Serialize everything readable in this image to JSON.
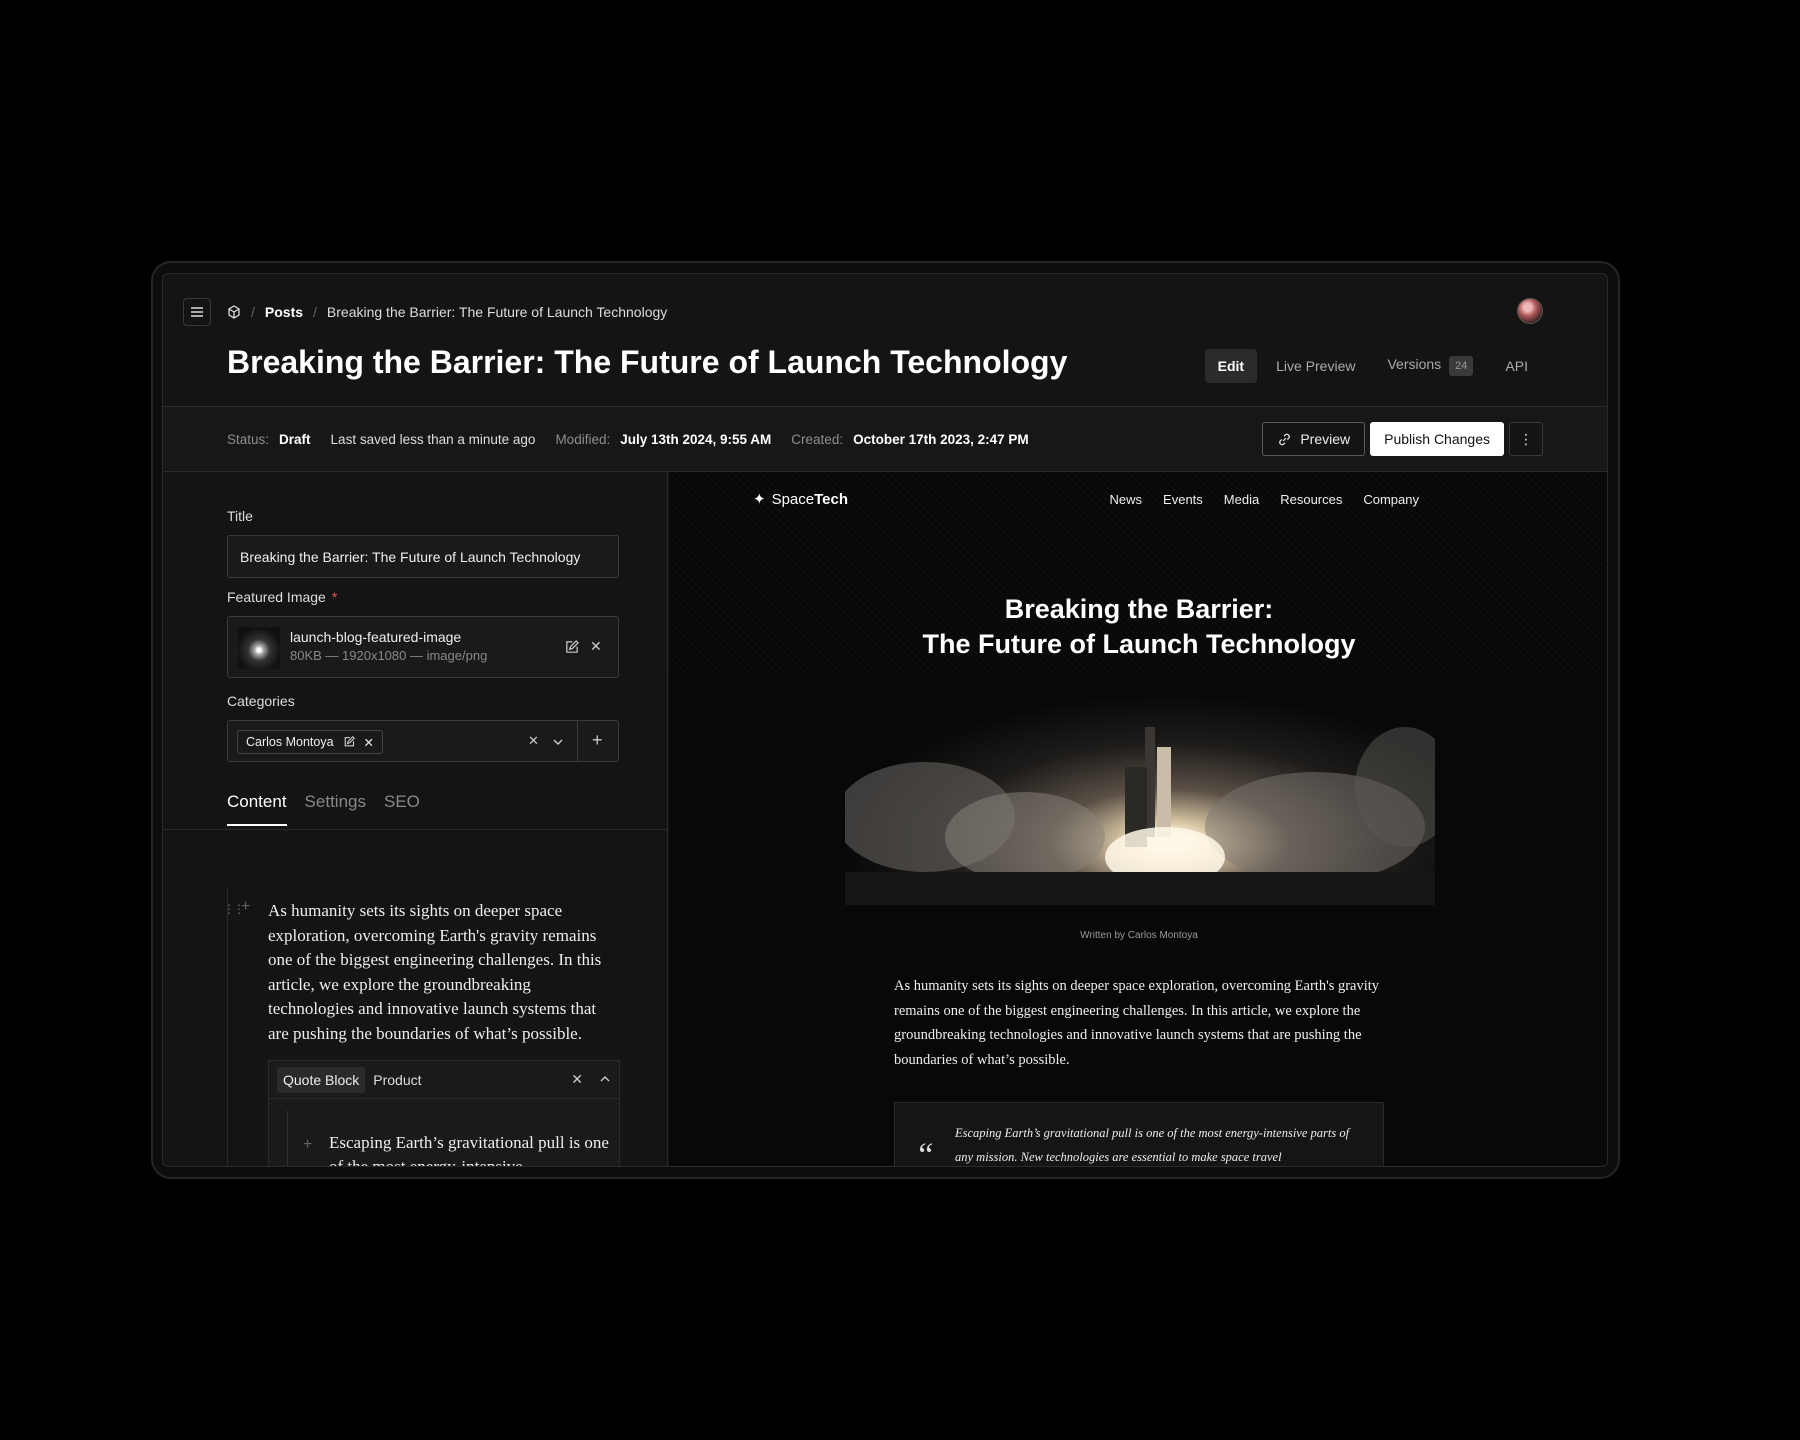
{
  "breadcrumb": {
    "section": "Posts",
    "current": "Breaking the Barrier: The Future of Launch Technology"
  },
  "page": {
    "title": "Breaking the Barrier: The Future of Launch Technology"
  },
  "view_tabs": {
    "edit": "Edit",
    "live_preview": "Live Preview",
    "versions": "Versions",
    "versions_count": "24",
    "api": "API"
  },
  "status": {
    "status_label": "Status:",
    "status_value": "Draft",
    "saved": "Last saved less than a minute ago",
    "modified_label": "Modified:",
    "modified_value": "July 13th 2024, 9:55 AM",
    "created_label": "Created:",
    "created_value": "October 17th 2023, 2:47 PM"
  },
  "actions": {
    "preview": "Preview",
    "publish": "Publish Changes"
  },
  "form": {
    "title_label": "Title",
    "title_value": "Breaking the Barrier: The Future of Launch Technology",
    "image_label": "Featured Image",
    "image_required": "*",
    "image_name": "launch-blog-featured-image",
    "image_meta": "80KB — 1920x1080 — image/png",
    "categories_label": "Categories",
    "category_chip": "Carlos Montoya"
  },
  "content_tabs": {
    "content": "Content",
    "settings": "Settings",
    "seo": "SEO"
  },
  "editor": {
    "paragraph": "As humanity sets its sights on deeper space exploration, overcoming Earth's gravity remains one of the biggest engineering challenges. In this article, we explore the groundbreaking technologies and innovative launch systems that are pushing the boundaries of what’s possible.",
    "block_type": "Quote Block",
    "block_name": "Product",
    "quote_text": "Escaping Earth’s gravitational pull is one of the most energy-intensive"
  },
  "site": {
    "logo_light": "Space",
    "logo_bold": "Tech",
    "nav": [
      "News",
      "Events",
      "Media",
      "Resources",
      "Company"
    ],
    "title_line1": "Breaking the Barrier:",
    "title_line2": "The Future of Launch Technology",
    "byline": "Written by Carlos Montoya",
    "body": "As humanity sets its sights on deeper space exploration, overcoming Earth's gravity remains one of the biggest engineering challenges. In this article, we explore the groundbreaking technologies and innovative launch systems that are pushing the boundaries of what’s possible.",
    "quote": "Escaping Earth’s gravitational pull is one of the most energy-intensive parts of any mission. New technologies are essential to make space travel"
  },
  "icons": {
    "menu": "menu-icon",
    "logo": "cube-logo-icon",
    "link": "link-icon",
    "more": "more-vertical-icon",
    "edit": "edit-icon",
    "close": "close-icon",
    "chevron": "chevron-down-icon",
    "add": "plus-icon",
    "sparkle": "sparkle-icon"
  },
  "colors": {
    "background": "#141414",
    "primary_button": "#ffffff",
    "required": "#ff4d4d"
  }
}
